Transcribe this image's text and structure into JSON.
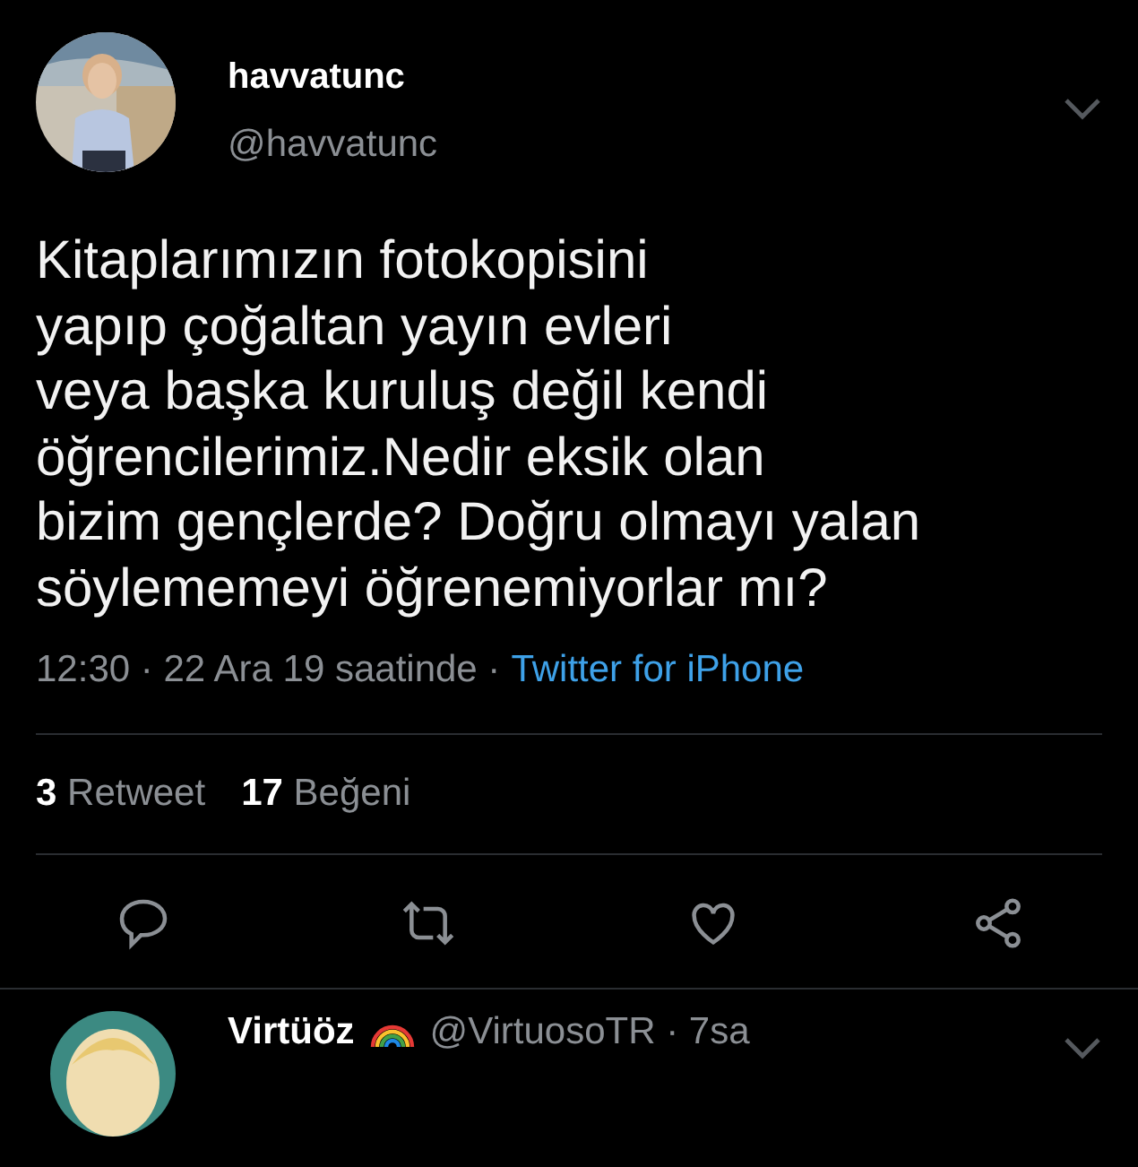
{
  "tweet": {
    "name": "havvatunc",
    "handle": "@havvatunc",
    "text_lines": [
      "Kitaplarımızın fotokopisini",
      "yapıp çoğaltan yayın evleri",
      "veya başka kuruluş değil kendi",
      "öğrencilerimiz.Nedir eksik olan",
      "bizim gençlerde? Doğru olmayı yalan",
      "söylememeyi öğrenemiyorlar mı?"
    ],
    "time": "12:30 · 22 Ara 19 saatinde ·",
    "source": "Twitter for iPhone",
    "stats": [
      {
        "count": "3",
        "label": "Retweet"
      },
      {
        "count": "17",
        "label": "Beğeni"
      }
    ],
    "actions": [
      {
        "kind": "reply"
      },
      {
        "kind": "retweet"
      },
      {
        "kind": "like"
      },
      {
        "kind": "share"
      }
    ]
  },
  "next_reply": {
    "name": "Virtüöz",
    "handle": "@VirtuosoTR · 7sa"
  }
}
